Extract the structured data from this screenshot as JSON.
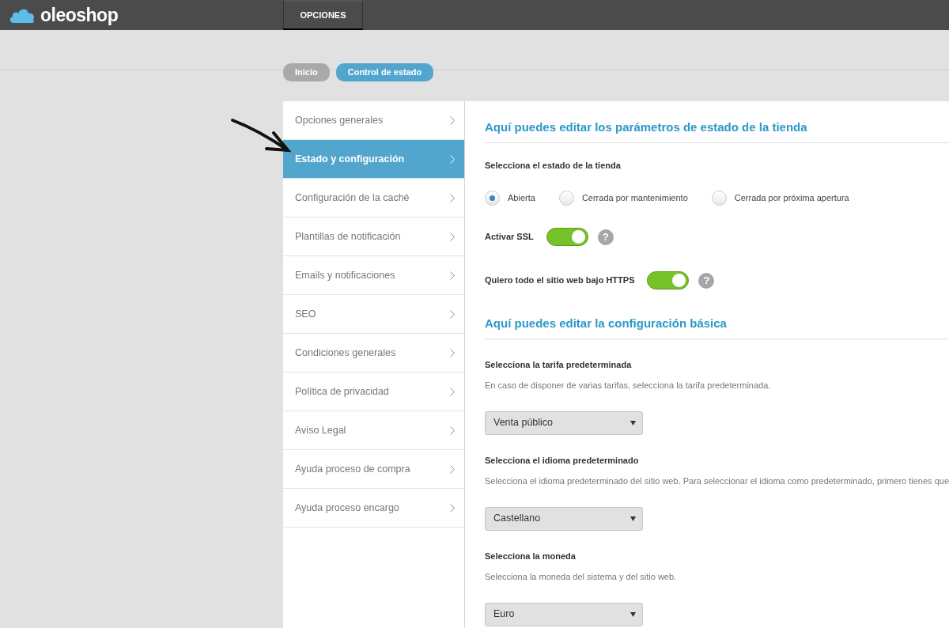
{
  "topbar": {
    "logo": "oleoshop",
    "tabs": [
      {
        "label": "OPCIONES",
        "selected": false
      }
    ]
  },
  "breadcrumb": [
    {
      "label": "Inicio",
      "selected": false
    },
    {
      "label": "Control de estado",
      "selected": true
    }
  ],
  "sidebar": {
    "items": [
      {
        "label": "Opciones generales",
        "selected": false
      },
      {
        "label": "Estado y configuración",
        "selected": true
      },
      {
        "label": "Configuración de la caché",
        "selected": false
      },
      {
        "label": "Plantillas de notificación",
        "selected": false
      },
      {
        "label": "Emails y notificaciones",
        "selected": false
      },
      {
        "label": "SEO",
        "selected": false
      },
      {
        "label": "Condiciones generales",
        "selected": false
      },
      {
        "label": "Política de privacidad",
        "selected": false
      },
      {
        "label": "Aviso Legal",
        "selected": false
      },
      {
        "label": "Ayuda proceso de compra",
        "selected": false
      },
      {
        "label": "Ayuda proceso encargo",
        "selected": false
      }
    ]
  },
  "sections": [
    {
      "title": "Aquí puedes editar los parámetros de estado de la tienda",
      "fields": [
        {
          "kind": "radio",
          "label": "Selecciona el estado de la tienda",
          "options": [
            {
              "label": "Abierta",
              "selected": true
            },
            {
              "label": "Cerrada por mantenimiento",
              "selected": false
            },
            {
              "label": "Cerrada por próxima apertura",
              "selected": false
            }
          ]
        },
        {
          "kind": "toggle",
          "label": "Activar SSL",
          "on": true,
          "help": "?"
        },
        {
          "kind": "toggle",
          "label": "Quiero todo el sitio web bajo HTTPS",
          "on": true,
          "help": "?"
        }
      ]
    },
    {
      "title": "Aquí puedes editar la configuración básica",
      "fields": [
        {
          "kind": "select",
          "label": "Selecciona la tarifa predeterminada",
          "hint": "En caso de disponer de varias tarifas, selecciona la tarifa predeterminada.",
          "value": "Venta público"
        },
        {
          "kind": "select",
          "label": "Selecciona el idioma predeterminado",
          "hint": "Selecciona el idioma predeterminado del sitio web. Para seleccionar el idioma como predeterminado, primero tienes que",
          "value": "Castellano"
        },
        {
          "kind": "select",
          "label": "Selecciona la moneda",
          "hint": "Selecciona la moneda del sistema y del sitio web.",
          "value": "Euro"
        }
      ]
    }
  ]
}
